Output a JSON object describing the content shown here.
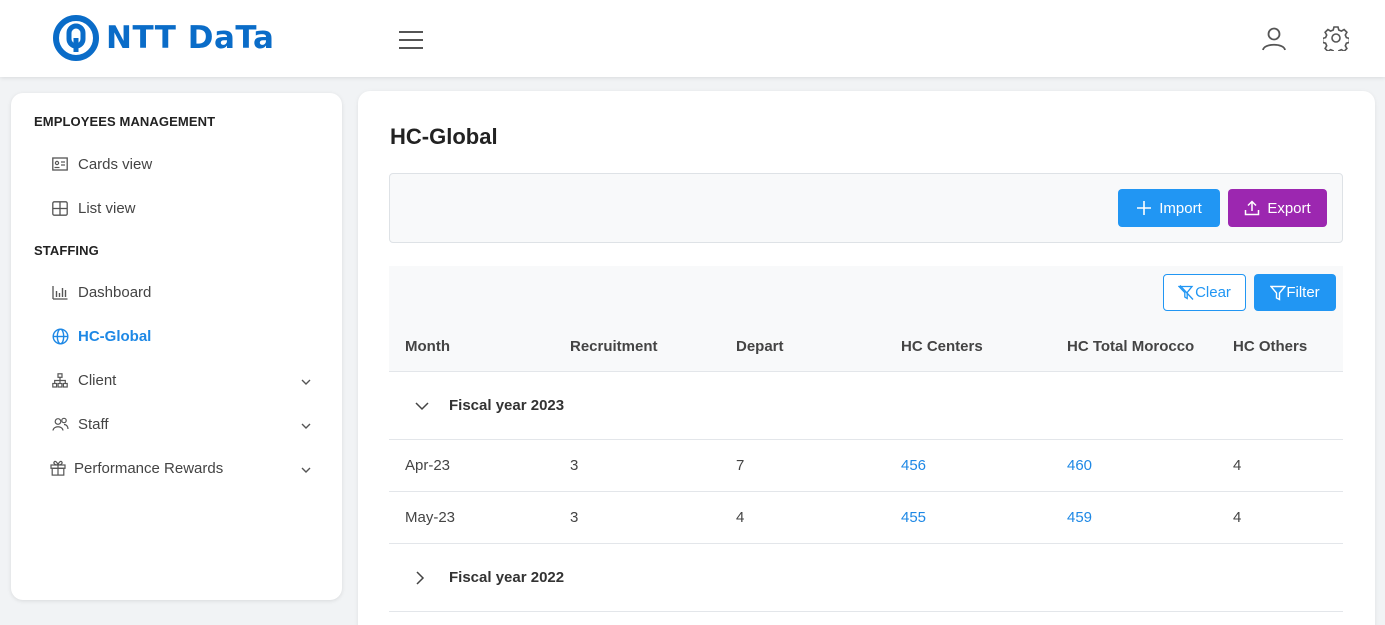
{
  "header": {
    "logo_text": "NTT DaTa",
    "icons": [
      "menu-icon",
      "user-icon",
      "settings-gear-icon"
    ],
    "brand_color": "#0a6cc8"
  },
  "sidebar": {
    "sections": [
      {
        "title": "EMPLOYEES MANAGEMENT",
        "items": [
          {
            "label": "Cards view",
            "icon": "id-card-icon"
          },
          {
            "label": "List view",
            "icon": "table-grid-icon"
          }
        ]
      },
      {
        "title": "STAFFING",
        "items": [
          {
            "label": "Dashboard",
            "icon": "bar-chart-icon"
          },
          {
            "label": "HC-Global",
            "icon": "globe-icon",
            "active": true
          },
          {
            "label": "Client",
            "icon": "sitemap-icon",
            "expandable": true
          },
          {
            "label": "Staff",
            "icon": "users-icon",
            "expandable": true
          },
          {
            "label": "Performance Rewards",
            "icon": "gift-icon",
            "expandable": true
          }
        ]
      }
    ]
  },
  "main": {
    "title": "HC-Global",
    "toolbar": {
      "import_label": "Import",
      "export_label": "Export",
      "import_color": "#2196f3",
      "export_color": "#9c27b0"
    },
    "table": {
      "clear_label": "Clear",
      "filter_label": "Filter",
      "columns": [
        "Month",
        "Recruitment",
        "Depart",
        "HC Centers",
        "HC Total Morocco",
        "HC Others"
      ],
      "groups": [
        {
          "label": "Fiscal year 2023",
          "expanded": true,
          "rows": [
            [
              "Apr-23",
              "3",
              "7",
              "456",
              "460",
              "4"
            ],
            [
              "May-23",
              "3",
              "4",
              "455",
              "459",
              "4"
            ]
          ]
        },
        {
          "label": "Fiscal year 2022",
          "expanded": false,
          "rows": []
        }
      ]
    }
  }
}
